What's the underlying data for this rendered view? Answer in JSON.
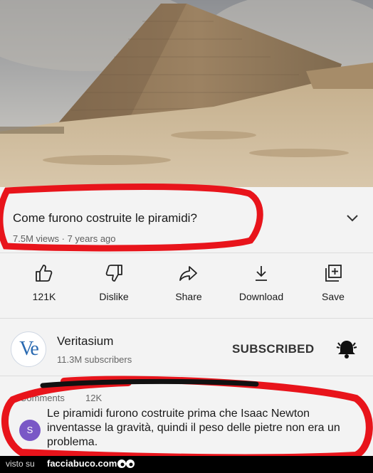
{
  "video": {
    "title": "Come furono costruite le piramidi?",
    "meta": "7.5M views · 7 years ago"
  },
  "actions": [
    {
      "icon": "thumbs-up-icon",
      "label": "121K"
    },
    {
      "icon": "thumbs-down-icon",
      "label": "Dislike"
    },
    {
      "icon": "share-icon",
      "label": "Share"
    },
    {
      "icon": "download-icon",
      "label": "Download"
    },
    {
      "icon": "save-icon",
      "label": "Save"
    }
  ],
  "channel": {
    "avatar_text": "Ve",
    "name": "Veritasium",
    "subscribers": "11.3M subscribers",
    "subscribe_label": "SUBSCRIBED"
  },
  "comments": {
    "header": "Comments",
    "count": "12K",
    "avatar_letter": "S",
    "text": "Le piramidi furono costruite prima che Isaac Newton inventasse la gravità, quindi il peso delle pietre non era un problema."
  },
  "footer": {
    "visto": "visto su",
    "site": "facciabuco.com"
  },
  "colors": {
    "annotation": "#e8141b",
    "brand": "#2a6ab1"
  }
}
